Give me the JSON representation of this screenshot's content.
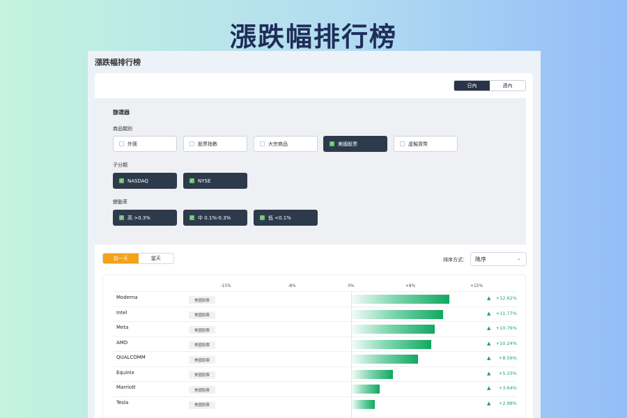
{
  "hero_title": "漲跌幅排行榜",
  "window_title": "漲跌幅排行榜",
  "range_toggle": {
    "options": [
      "日內",
      "週內"
    ],
    "active": 0
  },
  "filter": {
    "title": "篩選器",
    "category": {
      "label": "商品類別",
      "options": [
        {
          "label": "外匯",
          "checked": false
        },
        {
          "label": "股票指數",
          "checked": false
        },
        {
          "label": "大宗商品",
          "checked": false
        },
        {
          "label": "美國股票",
          "checked": true
        },
        {
          "label": "虛擬貨幣",
          "checked": false
        }
      ]
    },
    "subcategory": {
      "label": "子分類",
      "options": [
        {
          "label": "NASDAQ",
          "checked": true
        },
        {
          "label": "NYSE",
          "checked": true
        }
      ]
    },
    "volatility": {
      "label": "變動率",
      "options": [
        {
          "label": "高 >0.3%",
          "checked": true
        },
        {
          "label": "中 0.1%-0.3%",
          "checked": true
        },
        {
          "label": "低 <0.1%",
          "checked": true
        }
      ]
    }
  },
  "day_toggle": {
    "options": [
      "前一天",
      "當天"
    ],
    "active": 0
  },
  "sort": {
    "label": "排序方式：",
    "value": "降序"
  },
  "axis": {
    "ticks": [
      "-15%",
      "-8%",
      "0%",
      "+8%",
      "+15%"
    ]
  },
  "colors": {
    "accent": "#f5a11a",
    "dark": "#2a3446",
    "up": "#1aa463"
  },
  "rows": [
    {
      "name": "Moderna",
      "tag": "美國股票",
      "value": 12.62,
      "label": "+12.62%"
    },
    {
      "name": "Intel",
      "tag": "美國股票",
      "value": 11.77,
      "label": "+11.77%"
    },
    {
      "name": "Meta",
      "tag": "美國股票",
      "value": 10.76,
      "label": "+10.76%"
    },
    {
      "name": "AMD",
      "tag": "美國股票",
      "value": 10.24,
      "label": "+10.24%"
    },
    {
      "name": "QUALCOMM",
      "tag": "美國股票",
      "value": 8.56,
      "label": "+8.56%"
    },
    {
      "name": "Equinix",
      "tag": "美國股票",
      "value": 5.33,
      "label": "+5.33%"
    },
    {
      "name": "Marriott",
      "tag": "美國股票",
      "value": 3.64,
      "label": "+3.64%"
    },
    {
      "name": "Tesla",
      "tag": "美國股票",
      "value": 2.98,
      "label": "+2.98%"
    }
  ]
}
